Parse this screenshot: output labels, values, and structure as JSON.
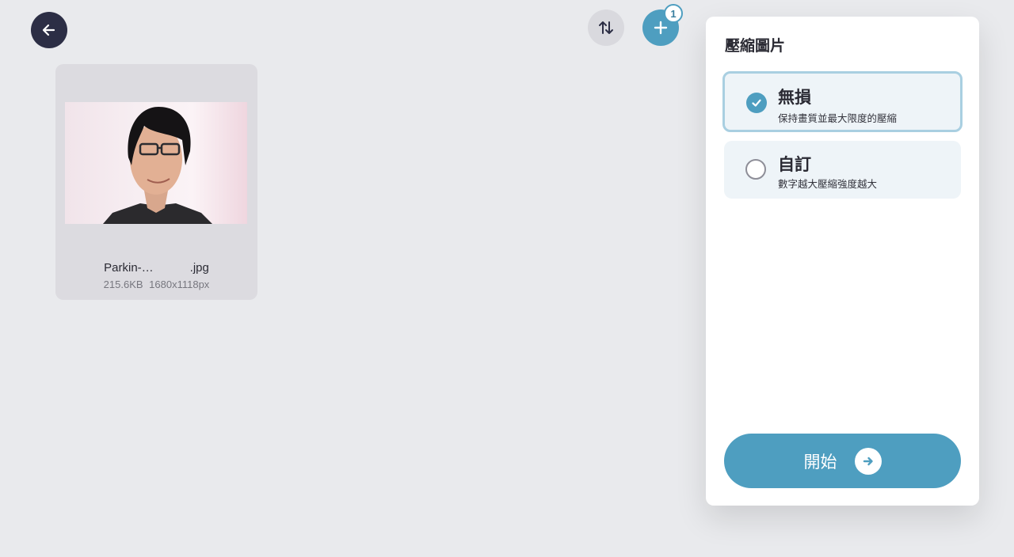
{
  "toolbar": {
    "back_icon": "arrow-left-icon",
    "sort_icon": "sort-arrows-icon",
    "add_icon": "plus-icon",
    "add_badge_count": "1"
  },
  "files": [
    {
      "name_start": "Parkin-…",
      "name_end": ".jpg",
      "size": "215.6KB",
      "dimensions": "1680x1118px"
    }
  ],
  "panel": {
    "title": "壓縮圖片",
    "options": [
      {
        "title": "無損",
        "description": "保持畫質並最大限度的壓縮",
        "selected": true
      },
      {
        "title": "自訂",
        "description": "數字越大壓縮強度越大",
        "selected": false
      }
    ],
    "start_label": "開始",
    "start_icon": "arrow-right-icon"
  },
  "colors": {
    "accent": "#4e9ec0",
    "dark": "#2c2e45",
    "background": "#e9eaed"
  }
}
